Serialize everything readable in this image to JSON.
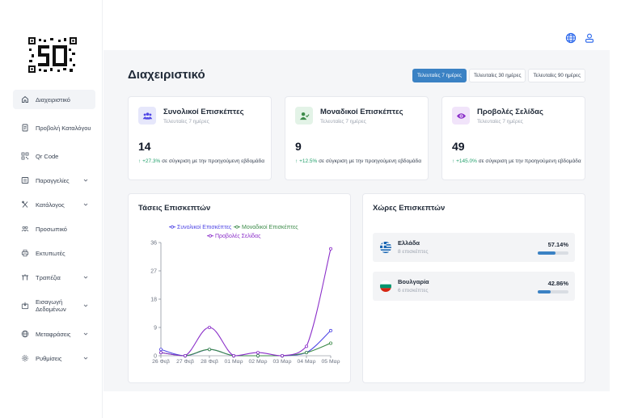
{
  "colors": {
    "accent": "#3b82c4",
    "series_total": "#4f46e5",
    "series_unique": "#3d8b4a",
    "series_views": "#8b2fc9",
    "positive": "#22a06b"
  },
  "sidebar": {
    "items": [
      {
        "label": "Διαχειριστικό",
        "icon": "home-icon",
        "active": true,
        "chevron": false
      },
      {
        "label": "Προβολή Καταλόγου",
        "icon": "document-icon",
        "active": false,
        "chevron": false
      },
      {
        "label": "Qr Code",
        "icon": "qr-icon",
        "active": false,
        "chevron": false
      },
      {
        "label": "Παραγγελίες",
        "icon": "list-icon",
        "active": false,
        "chevron": true
      },
      {
        "label": "Κατάλογος",
        "icon": "utensils-icon",
        "active": false,
        "chevron": true
      },
      {
        "label": "Προσωπικό",
        "icon": "users-icon",
        "active": false,
        "chevron": false
      },
      {
        "label": "Εκτυπωτές",
        "icon": "printer-icon",
        "active": false,
        "chevron": false
      },
      {
        "label": "Τραπέζια",
        "icon": "table-icon",
        "active": false,
        "chevron": true
      },
      {
        "label": "Εισαγωγή Δεδομένων",
        "icon": "import-icon",
        "active": false,
        "chevron": true
      },
      {
        "label": "Μεταφράσεις",
        "icon": "globe-icon",
        "active": false,
        "chevron": true
      },
      {
        "label": "Ρυθμίσεις",
        "icon": "gear-icon",
        "active": false,
        "chevron": true
      }
    ]
  },
  "topbar": {
    "language_icon": "globe-icon",
    "user_icon": "user-icon"
  },
  "main": {
    "title": "Διαχειριστικό",
    "ranges": [
      {
        "label": "Τελευταίες 7 ημέρες",
        "active": true
      },
      {
        "label": "Τελευταίες 30 ημέρες",
        "active": false
      },
      {
        "label": "Τελευταίες 90 ημέρες",
        "active": false
      }
    ]
  },
  "stats": [
    {
      "title": "Συνολικοί Επισκέπτες",
      "subtitle": "Τελευταίες 7 ημέρες",
      "value": "14",
      "change": "+27.3%",
      "change_text": "σε σύγκριση με την προηγούμενη εβδομάδα",
      "icon": "users-icon",
      "icon_bg": "#e6e7fb",
      "icon_color": "#4f46e5"
    },
    {
      "title": "Μοναδικοί Επισκέπτες",
      "subtitle": "Τελευταίες 7 ημέρες",
      "value": "9",
      "change": "+12.5%",
      "change_text": "σε σύγκριση με την προηγούμενη εβδομάδα",
      "icon": "user-check-icon",
      "icon_bg": "#e3f3e7",
      "icon_color": "#3d8b4a"
    },
    {
      "title": "Προβολές Σελίδας",
      "subtitle": "Τελευταίες 7 ημέρες",
      "value": "49",
      "change": "+145.0%",
      "change_text": "σε σύγκριση με την προηγούμενη εβδομάδα",
      "icon": "eye-icon",
      "icon_bg": "#f1e4fa",
      "icon_color": "#8b2fc9"
    }
  ],
  "trends": {
    "title": "Τάσεις Επισκεπτών"
  },
  "countries": {
    "title": "Χώρες Επισκεπτών",
    "items": [
      {
        "name": "Ελλάδα",
        "visitors": "8 επισκέπτες",
        "percent": "57.14%",
        "share": 57.14,
        "flag": "greece-flag"
      },
      {
        "name": "Βουλγαρία",
        "visitors": "6 επισκέπτες",
        "percent": "42.86%",
        "share": 42.86,
        "flag": "bulgaria-flag"
      }
    ]
  },
  "chart_data": {
    "type": "line",
    "title": "Τάσεις Επισκεπτών",
    "categories": [
      "26 Φεβ",
      "27 Φεβ",
      "28 Φεβ",
      "01 Μαρ",
      "02 Μαρ",
      "03 Μαρ",
      "04 Μαρ",
      "05 Μαρ"
    ],
    "ylim": [
      0,
      36
    ],
    "yticks": [
      "0",
      "9",
      "18",
      "27",
      "36"
    ],
    "legend": "top",
    "grid": false,
    "series": [
      {
        "name": "Συνολικοί Επισκέπτες",
        "color": "#4f46e5",
        "values": [
          2,
          0,
          2,
          0,
          0,
          0,
          1,
          8
        ]
      },
      {
        "name": "Μοναδικοί Επισκέπτες",
        "color": "#3d8b4a",
        "values": [
          1,
          0,
          2,
          0,
          0,
          0,
          1,
          4
        ]
      },
      {
        "name": "Προβολές Σελίδας",
        "color": "#8b2fc9",
        "values": [
          1,
          0,
          9,
          0,
          1,
          0,
          3,
          34
        ]
      }
    ]
  }
}
